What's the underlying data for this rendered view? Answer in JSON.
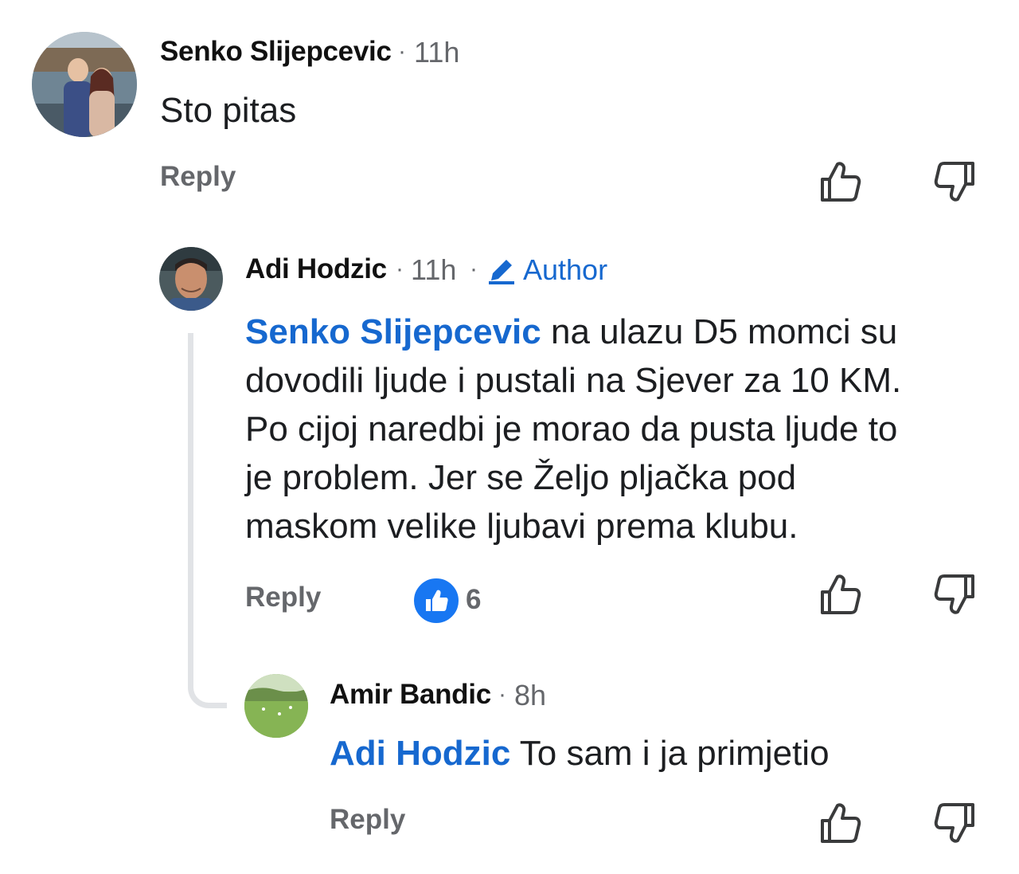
{
  "comments": [
    {
      "author": "Senko Slijepcevic",
      "time": "11h",
      "text": "Sto pitas",
      "reply_label": "Reply"
    },
    {
      "author": "Adi Hodzic",
      "time": "11h",
      "badge": "Author",
      "mention": "Senko Slijepcevic",
      "text_lines": [
        "na ulazu D5 momci su",
        "dovodili ljude i pustali na Sjever za 10 KM.",
        "Po cijoj naredbi je morao da pusta ljude to",
        "je problem. Jer se Željo pljačka pod",
        "maskom velike ljubavi prema klubu."
      ],
      "reply_label": "Reply",
      "reaction_count": "6"
    },
    {
      "author": "Amir Bandic",
      "time": "8h",
      "mention": "Adi Hodzic",
      "text": "To sam i ja primjetio",
      "reply_label": "Reply"
    }
  ],
  "colors": {
    "mention": "#1668cf",
    "muted": "#65676b",
    "like_blue": "#1877f2",
    "thread_line": "#e1e3e6"
  },
  "icons": {
    "upvote": "thumbs-up-outline-icon",
    "downvote": "thumbs-down-outline-icon",
    "author_badge": "pencil-icon",
    "reaction": "like-reaction-icon"
  }
}
